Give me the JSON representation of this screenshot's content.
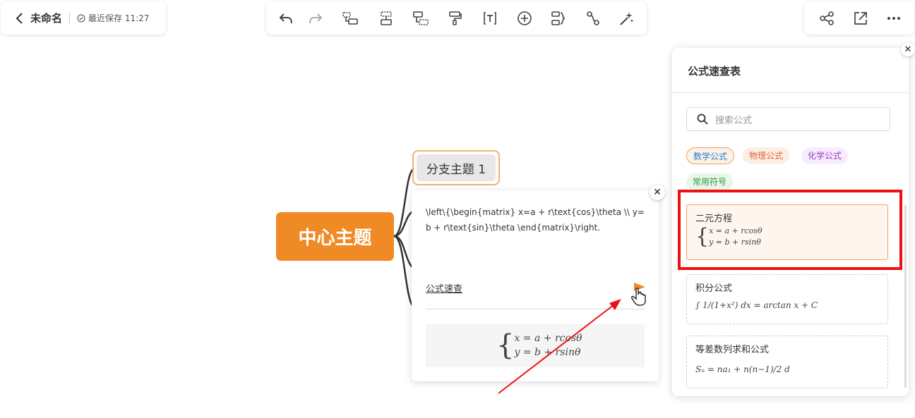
{
  "header": {
    "doc_title": "未命名",
    "save_status": "最近保存 11:27"
  },
  "toolbar": {
    "icons": [
      "undo-icon",
      "redo-icon",
      "insert-sibling-icon",
      "insert-child-icon",
      "insert-parent-icon",
      "format-painter-icon",
      "text-icon",
      "add-icon",
      "summary-icon",
      "relation-icon",
      "style-icon"
    ]
  },
  "topright": {
    "icons": [
      "share-icon",
      "export-icon",
      "more-icon"
    ]
  },
  "mindmap": {
    "center_topic": "中心主题",
    "branch_topic": "分支主题 1",
    "accent": "#f08a24"
  },
  "editor": {
    "latex_code": "\\left\\{\\begin{matrix}   x=a + r\\text{cos}\\theta \\\\ y=b + r\\text{sin}\\theta \\end{matrix}\\right.",
    "quick_link": "公式速查",
    "preview_line1": "x = a + rcosθ",
    "preview_line2": "y = b + rsinθ"
  },
  "panel": {
    "title": "公式速查表",
    "search_placeholder": "搜索公式",
    "tags": [
      {
        "label": "数学公式",
        "color": "#1f7fd0",
        "bg": "#fef1e6"
      },
      {
        "label": "物理公式",
        "color": "#e0643a",
        "bg": "#fdeee6"
      },
      {
        "label": "化学公式",
        "color": "#9b3bc9",
        "bg": "#f6ecfb"
      },
      {
        "label": "常用符号",
        "color": "#2a9a3f",
        "bg": "#e9f6ea"
      }
    ],
    "formulas": [
      {
        "title": "二元方程",
        "line1": "x = a + rcosθ",
        "line2": "y = b + rsinθ"
      },
      {
        "title": "积分公式",
        "expr": "∫ 1/(1+x²) dx = arctan x + C"
      },
      {
        "title": "等差数列求和公式",
        "expr": "Sₙ = na₁ + n(n−1)/2 d"
      }
    ]
  }
}
